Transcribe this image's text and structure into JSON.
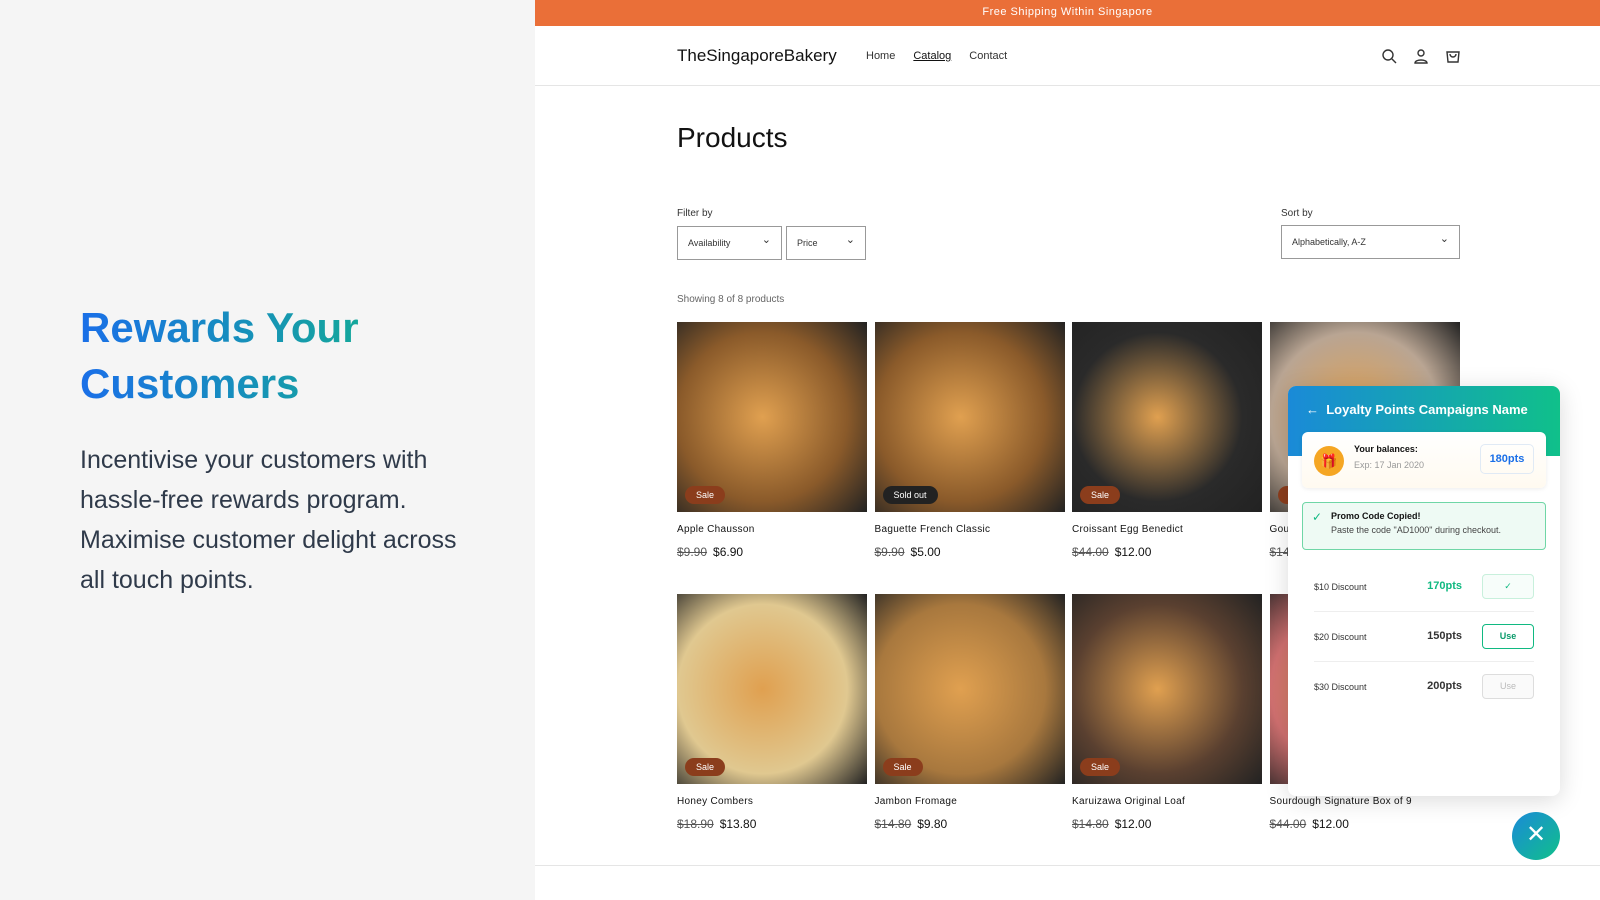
{
  "hero": {
    "title": "Rewards Your Customers",
    "description": "Incentivise your customers with hassle-free rewards program. Maximise customer delight across all touch points."
  },
  "store": {
    "banner": "Free Shipping Within Singapore",
    "logo": "TheSingaporeBakery",
    "nav": [
      {
        "label": "Home"
      },
      {
        "label": "Catalog",
        "active": true
      },
      {
        "label": "Contact"
      }
    ],
    "icons": [
      "search-icon",
      "account-icon",
      "cart-icon"
    ],
    "title": "Products",
    "filter_label": "Filter by",
    "filters": [
      "Availability",
      "Price"
    ],
    "sort_label": "Sort by",
    "sort_value": "Alphabetically, A-Z",
    "count": "Showing 8 of 8 products",
    "products": [
      {
        "name": "Apple Chausson",
        "old": "$9.90",
        "price": "$6.90",
        "badge": "Sale",
        "color": "#8a5a2a"
      },
      {
        "name": "Baguette French Classic",
        "old": "$9.90",
        "price": "$5.00",
        "badge": "Sold out",
        "color": "#8a5a2a"
      },
      {
        "name": "Croissant Egg Benedict",
        "old": "$44.00",
        "price": "$12.00",
        "badge": "Sale",
        "color": "#2a2a2a"
      },
      {
        "name": "Gourmet",
        "old": "$14",
        "price": "",
        "badge": "Sale",
        "color": "#b9a593"
      },
      {
        "name": "Honey Combers",
        "old": "$18.90",
        "price": "$13.80",
        "badge": "Sale",
        "color": "#e0c890"
      },
      {
        "name": "Jambon Fromage",
        "old": "$14.80",
        "price": "$9.80",
        "badge": "Sale",
        "color": "#a8783e"
      },
      {
        "name": "Karuizawa Original Loaf",
        "old": "$14.80",
        "price": "$12.00",
        "badge": "Sale",
        "color": "#5a4030"
      },
      {
        "name": "Sourdough Signature Box of 9",
        "old": "$44.00",
        "price": "$12.00",
        "badge": "",
        "color": "#d07070"
      }
    ]
  },
  "widget": {
    "title": "Loyalty Points Campaigns Name",
    "balance_label": "Your balances:",
    "expiry": "Exp: 17 Jan 2020",
    "balance": "180pts",
    "promo_title": "Promo Code Copied!",
    "promo_text": "Paste the code \"AD1000\" during checkout.",
    "rewards": [
      {
        "name": "$10 Discount",
        "points": "170pts",
        "action": "✓",
        "state": "used"
      },
      {
        "name": "$20 Discount",
        "points": "150pts",
        "action": "Use",
        "state": "active"
      },
      {
        "name": "$30 Discount",
        "points": "200pts",
        "action": "Use",
        "state": "disabled"
      }
    ],
    "colors": {
      "accent": "#10b981",
      "blue": "#1a6fe8"
    }
  }
}
